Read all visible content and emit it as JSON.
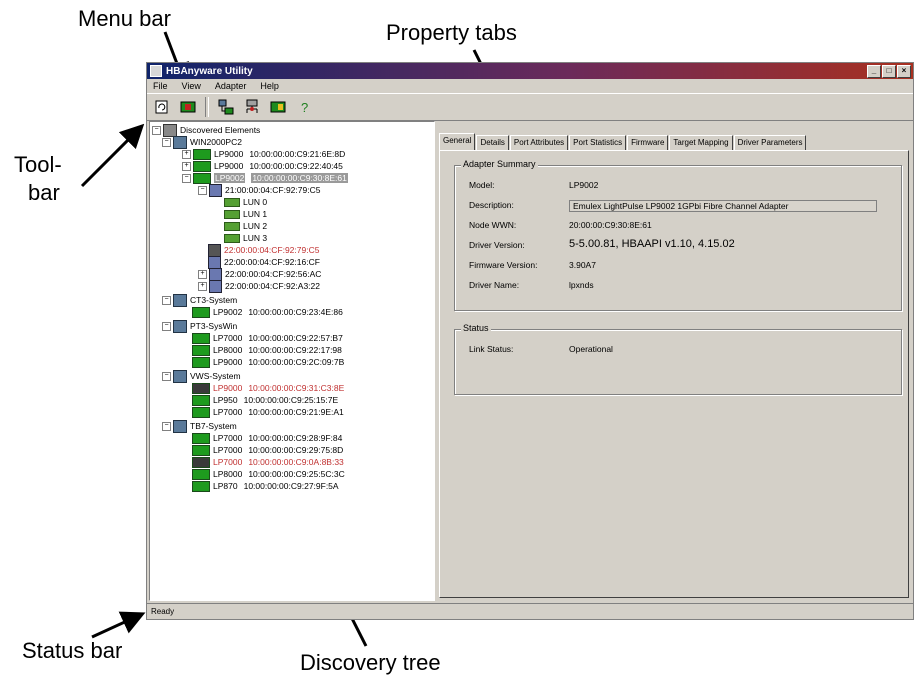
{
  "callouts": {
    "menu_bar": "Menu bar",
    "property_tabs": "Property tabs",
    "toolbar_line1": "Tool-",
    "toolbar_line2": "bar",
    "status_bar": "Status bar",
    "discovery_tree": "Discovery tree"
  },
  "window": {
    "title": "HBAnyware Utility",
    "btn_min": "_",
    "btn_max": "□",
    "btn_close": "×"
  },
  "menu": [
    "File",
    "View",
    "Adapter",
    "Help"
  ],
  "tree": {
    "root": "Discovered Elements",
    "hosts": [
      {
        "name": "WIN2000PC2",
        "adapters": [
          {
            "model": "LP9000",
            "wwn": "10:00:00:00:C9:21:6E:8D",
            "red": false
          },
          {
            "model": "LP9000",
            "wwn": "10:00:00:00:C9:22:40:45",
            "red": false
          },
          {
            "model": "LP9002",
            "wwn": "10:00:00:00:C9:30:8E:61",
            "red": false,
            "selected": true
          }
        ]
      },
      {
        "name": "CT3-System",
        "adapters": [
          {
            "model": "LP9002",
            "wwn": "10:00:00:00:C9:23:4E:86",
            "red": false
          }
        ]
      },
      {
        "name": "PT3-SysWin",
        "adapters": [
          {
            "model": "LP7000",
            "wwn": "10:00:00:00:C9:22:57:B7",
            "red": false
          },
          {
            "model": "LP8000",
            "wwn": "10:00:00:00:C9:22:17:98",
            "red": false
          },
          {
            "model": "LP9000",
            "wwn": "10:00:00:00:C9:2C:09:7B",
            "red": false
          }
        ]
      },
      {
        "name": "VWS-System",
        "adapters": [
          {
            "model": "LP9000",
            "wwn": "10:00:00:00:C9:31:C3:8E",
            "red": true
          },
          {
            "model": "LP950",
            "wwn": "10:00:00:00:C9:25:15:7E",
            "red": false
          },
          {
            "model": "LP7000",
            "wwn": "10:00:00:00:C9:21:9E:A1",
            "red": false
          }
        ]
      },
      {
        "name": "TB7-System",
        "adapters": [
          {
            "model": "LP7000",
            "wwn": "10:00:00:00:C9:28:9F:84",
            "red": false
          },
          {
            "model": "LP7000",
            "wwn": "10:00:00:00:C9:29:75:8D",
            "red": false
          },
          {
            "model": "LP7000",
            "wwn": "10:00:00:00:C9:0A:8B:33",
            "red": true
          },
          {
            "model": "LP8000",
            "wwn": "10:00:00:00:C9:25:5C:3C",
            "red": false
          },
          {
            "model": "LP870",
            "wwn": "10:00:00:00:C9:27:9F:5A",
            "red": false
          }
        ]
      }
    ],
    "targets": [
      {
        "wwn": "21:00:00:04:CF:92:79:C5",
        "red": false
      },
      {
        "wwn": "22:00:00:04:CF:92:79:C5",
        "red": true
      },
      {
        "wwn": "22:00:00:04:CF:92:16:CF",
        "red": false
      },
      {
        "wwn": "22:00:00:04:CF:92:56:AC",
        "red": false
      },
      {
        "wwn": "22:00:00:04:CF:92:A3:22",
        "red": false
      }
    ],
    "luns": [
      "LUN 0",
      "LUN 1",
      "LUN 2",
      "LUN 3"
    ]
  },
  "tabs": [
    "General",
    "Details",
    "Port Attributes",
    "Port Statistics",
    "Firmware",
    "Target Mapping",
    "Driver Parameters"
  ],
  "adapter_summary": {
    "title": "Adapter Summary",
    "rows": [
      {
        "label": "Model:",
        "value": "LP9002"
      },
      {
        "label": "Description:",
        "value": "Emulex LightPulse LP9002 1GPbi Fibre Channel Adapter"
      },
      {
        "label": "Node WWN:",
        "value": "20:00:00:C9:30:8E:61"
      },
      {
        "label": "Driver Version:",
        "value": "5-5.00.81, HBAAPI v1.10, 4.15.02"
      },
      {
        "label": "Firmware Version:",
        "value": "3.90A7"
      },
      {
        "label": "Driver Name:",
        "value": "lpxnds"
      }
    ]
  },
  "status": {
    "title": "Status",
    "link_label": "Link Status:",
    "link_value": "Operational"
  },
  "statusbar": "Ready"
}
